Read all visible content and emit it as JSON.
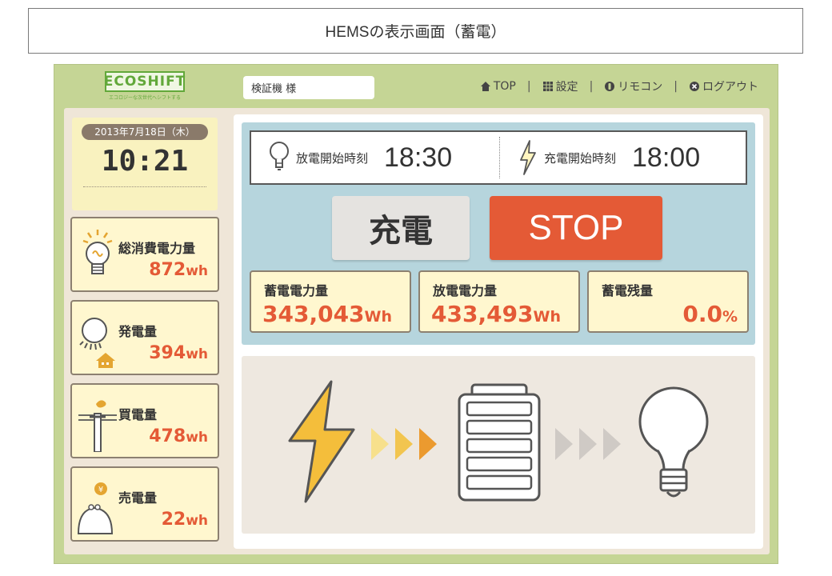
{
  "caption": "HEMSの表示画面（蓄電）",
  "header": {
    "logo_text": "ECOSHIFT",
    "logo_sub": "エコロジーな次世代へシフトする",
    "user": "検証機 様",
    "nav": [
      {
        "label": "TOP",
        "icon": "home-icon"
      },
      {
        "label": "設定",
        "icon": "grid-icon"
      },
      {
        "label": "リモコン",
        "icon": "remote-icon"
      },
      {
        "label": "ログアウト",
        "icon": "close-circle-icon"
      }
    ]
  },
  "clock": {
    "date": "2013年7月18日（木）",
    "time": "10:21"
  },
  "stats": [
    {
      "label": "総消費電力量",
      "value": "872",
      "unit": "wh",
      "icon": "bulb-icon"
    },
    {
      "label": "発電量",
      "value": "394",
      "unit": "wh",
      "icon": "sun-house-icon"
    },
    {
      "label": "買電量",
      "value": "478",
      "unit": "wh",
      "icon": "bird-pole-icon"
    },
    {
      "label": "売電量",
      "value": "22",
      "unit": "wh",
      "icon": "coin-purse-icon"
    }
  ],
  "schedule": {
    "discharge_label": "放電開始時刻",
    "discharge_time": "18:30",
    "charge_label": "充電開始時刻",
    "charge_time": "18:00"
  },
  "buttons": {
    "charge": "充電",
    "stop": "STOP"
  },
  "meters": [
    {
      "label": "蓄電電力量",
      "value": "343,043",
      "unit": "Wh"
    },
    {
      "label": "放電電力量",
      "value": "433,493",
      "unit": "Wh"
    },
    {
      "label": "蓄電残量",
      "value": "0.0",
      "unit": "%"
    }
  ],
  "colors": {
    "frame": "#c5d595",
    "accent_orange": "#e45a36",
    "panel_yellow": "#fff7cf",
    "blue_panel": "#b6d5dd"
  }
}
